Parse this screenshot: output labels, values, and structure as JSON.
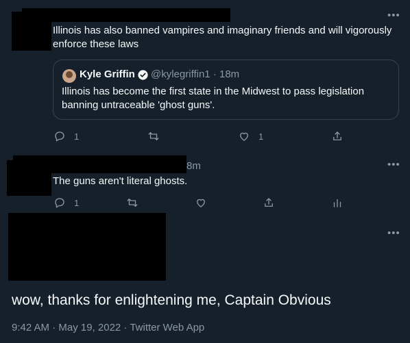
{
  "tweet1": {
    "text": "Illinois has also banned vampires and imaginary friends and will vigorously enforce these laws",
    "quoted": {
      "name": "Kyle Griffin",
      "handle_time": "@kylegriffin1 · 18m",
      "text": "Illinois has become the first state in the Midwest to pass legislation banning untraceable 'ghost guns'."
    },
    "actions": {
      "reply_count": "1",
      "like_count": "1"
    }
  },
  "tweet2": {
    "time": "8m",
    "text": "The guns aren't literal ghosts.",
    "actions": {
      "reply_count": "1"
    }
  },
  "tweet3": {
    "text": "wow, thanks for enlightening me, Captain Obvious",
    "meta": "9:42 AM · May 19, 2022 · Twitter Web App"
  },
  "icons": {
    "more": "more-horizontal-icon",
    "reply": "reply-icon",
    "retweet": "retweet-icon",
    "like": "heart-icon",
    "share": "share-icon",
    "analytics": "analytics-icon",
    "verified": "verified-badge-icon"
  },
  "colors": {
    "background": "#15202b",
    "text": "#f7f9f9",
    "muted": "#8b98a5",
    "border": "#38444d",
    "verified": "#1d9bf0"
  }
}
